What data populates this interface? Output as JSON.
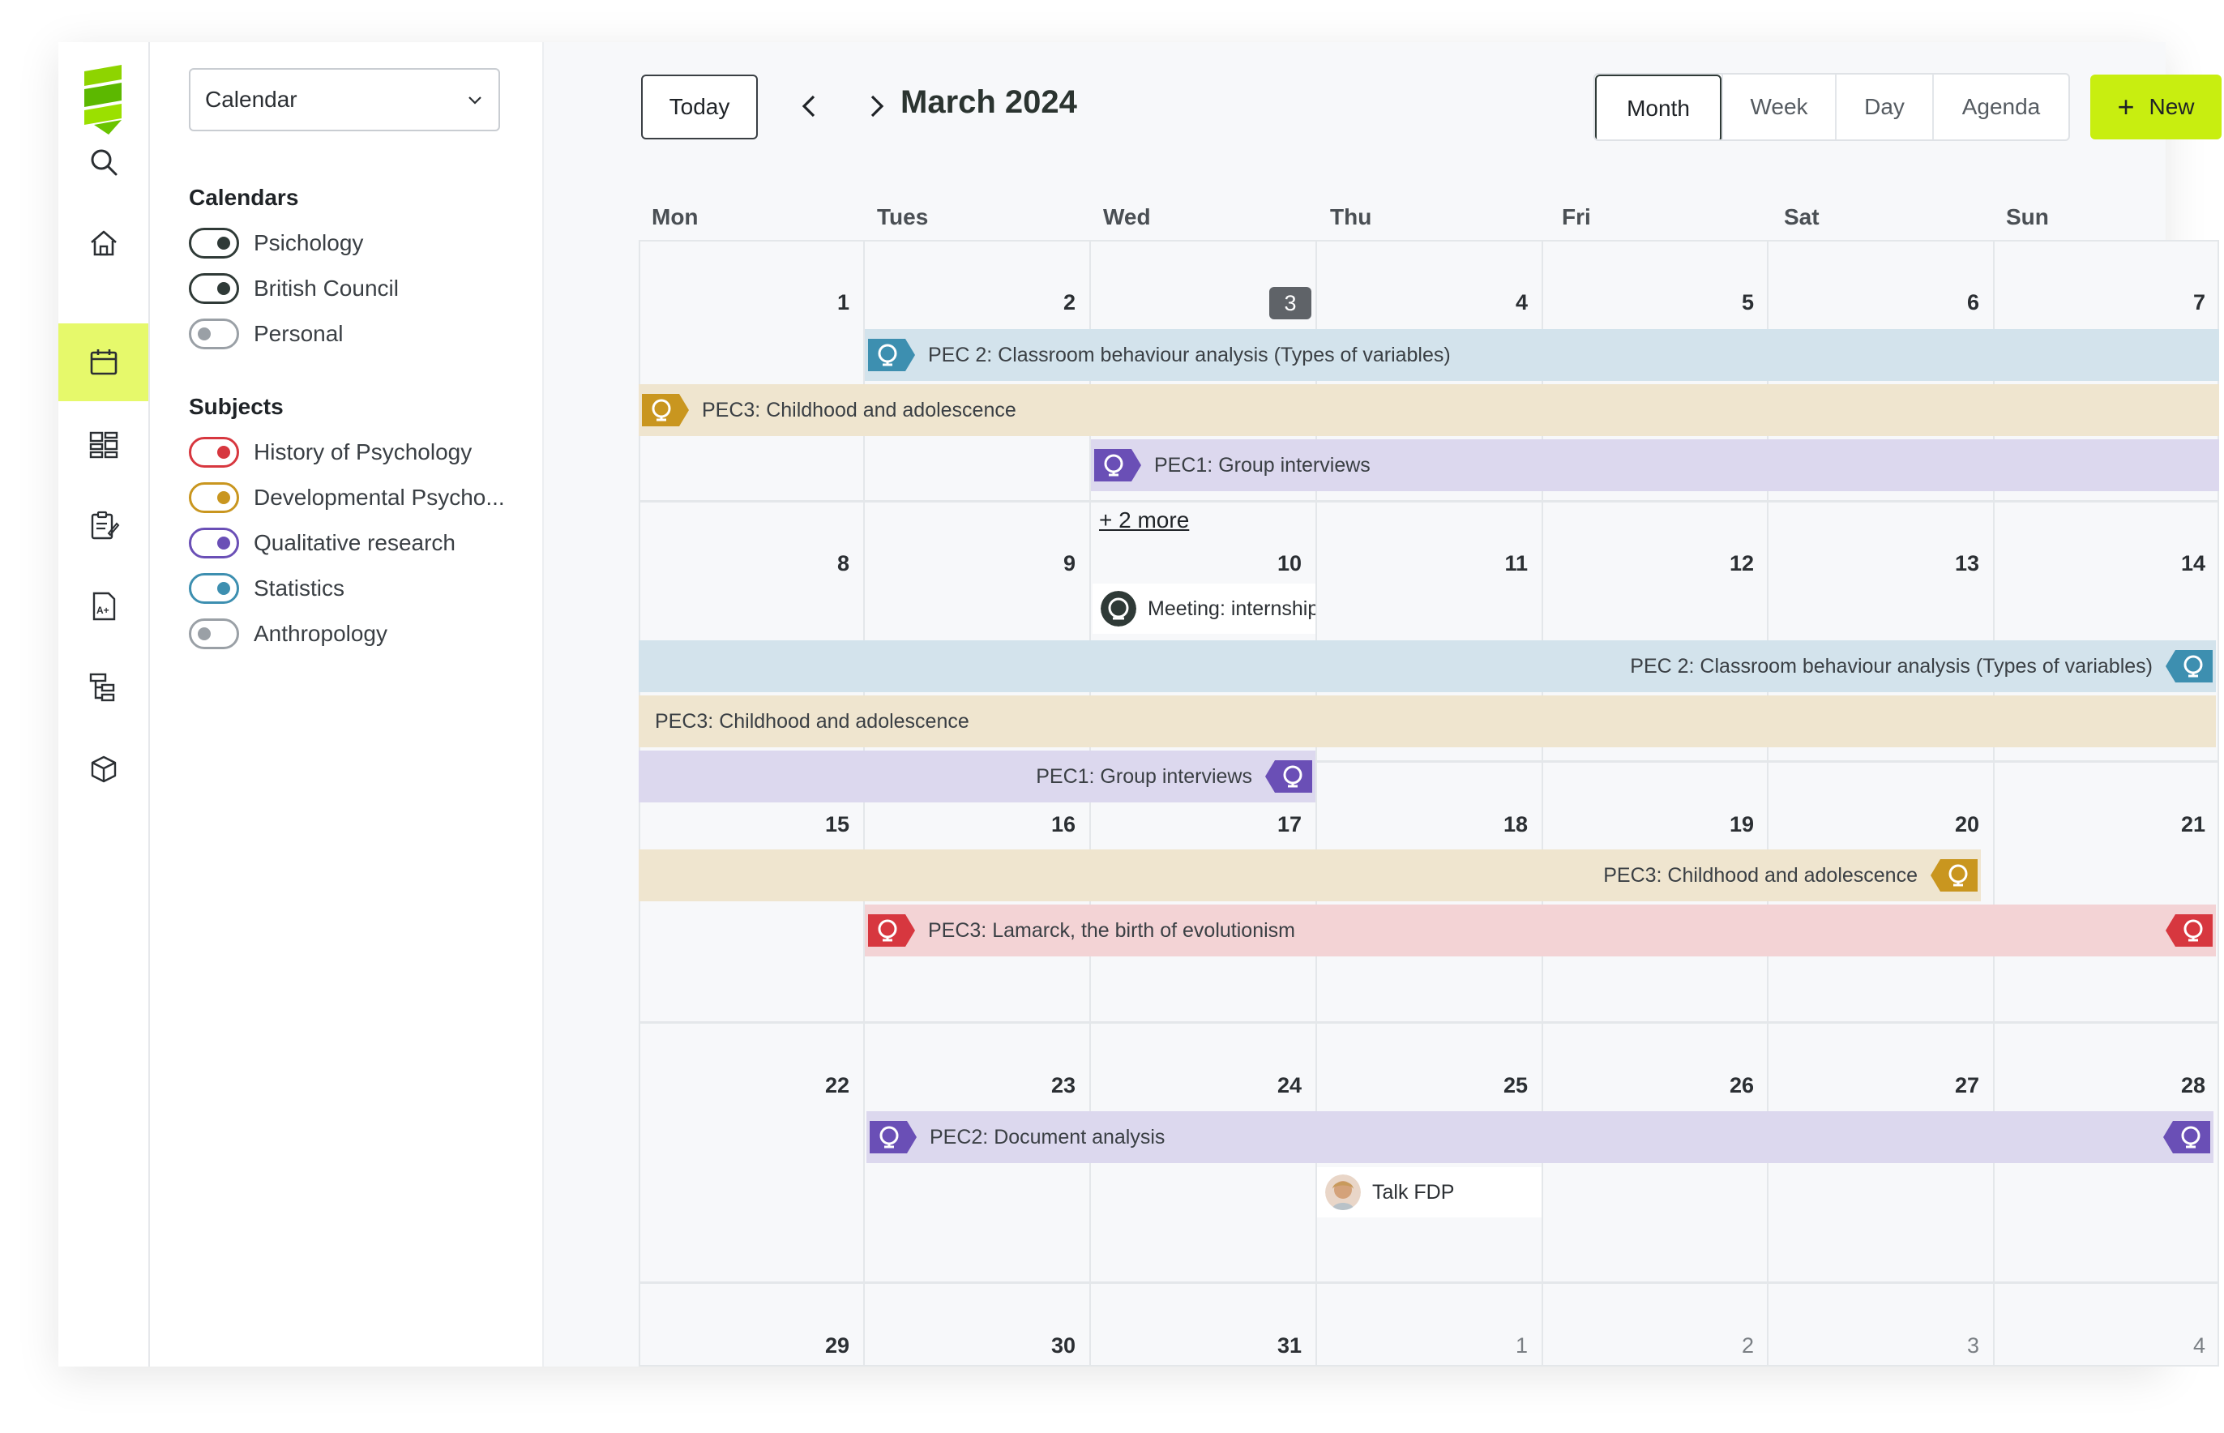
{
  "sidebar_select": {
    "value": "Calendar"
  },
  "calendars": {
    "title": "Calendars",
    "items": [
      {
        "label": "Psichology",
        "enabled": true,
        "color": "#2f3a37"
      },
      {
        "label": "British Council",
        "enabled": true,
        "color": "#2f3a37"
      },
      {
        "label": "Personal",
        "enabled": false,
        "color": "#9aa0a6"
      }
    ]
  },
  "subjects": {
    "title": "Subjects",
    "items": [
      {
        "label": "History of Psychology",
        "color": "#d7373f"
      },
      {
        "label": "Developmental Psycho...",
        "color": "#c9961f"
      },
      {
        "label": "Qualitative research",
        "color": "#6a4fb6"
      },
      {
        "label": "Statistics",
        "color": "#3d8fb0"
      },
      {
        "label": "Anthropology",
        "color": "#9aa0a6"
      }
    ]
  },
  "toolbar": {
    "today_label": "Today",
    "title": "March 2024",
    "views": [
      "Month",
      "Week",
      "Day",
      "Agenda"
    ],
    "active_view": "Month",
    "new_label": "New"
  },
  "weekdays": [
    "Mon",
    "Tues",
    "Wed",
    "Thu",
    "Fri",
    "Sat",
    "Sun"
  ],
  "weeks": [
    [
      "1",
      "2",
      "3",
      "4",
      "5",
      "6",
      "7"
    ],
    [
      "8",
      "9",
      "10",
      "11",
      "12",
      "13",
      "14"
    ],
    [
      "15",
      "16",
      "17",
      "18",
      "19",
      "20",
      "21"
    ],
    [
      "22",
      "23",
      "24",
      "25",
      "26",
      "27",
      "28"
    ],
    [
      "29",
      "30",
      "31",
      "1",
      "2",
      "3",
      "4"
    ]
  ],
  "today": "3",
  "events": {
    "pec2_classroom": "PEC 2: Classroom behaviour analysis (Types of variables)",
    "pec3_childhood": "PEC3: Childhood and adolescence",
    "pec1_group": "PEC1: Group interviews",
    "more": "+ 2 more",
    "meeting": "Meeting: internship",
    "pec3_lamarck": "PEC3: Lamarck, the birth of evolutionism",
    "pec2_document": "PEC2: Document analysis",
    "talk": "Talk FDP"
  },
  "colors": {
    "accent": "#c8ee10",
    "blue": "#3d8fb0",
    "sand": "#c9961f",
    "lilac": "#6a4fb6",
    "red": "#d7373f"
  },
  "icons": [
    "logo-icon",
    "search-icon",
    "home-icon",
    "calendar-icon",
    "dashboard-icon",
    "notes-icon",
    "grades-icon",
    "tree-icon",
    "box-icon",
    "chevron-down-icon",
    "chevron-left-icon",
    "chevron-right-icon",
    "plus-icon",
    "globe-icon"
  ]
}
